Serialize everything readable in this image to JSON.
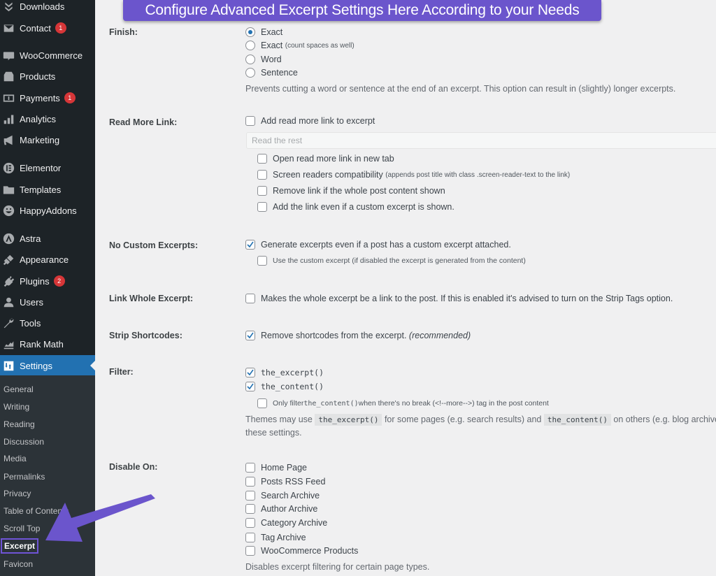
{
  "banner": {
    "text": "Configure Advanced Excerpt Settings Here According to your Needs"
  },
  "sidebar": {
    "items": [
      {
        "label": "Downloads",
        "icon": "download-icon",
        "badge": null
      },
      {
        "label": "Contact",
        "icon": "mail-icon",
        "badge": "1"
      },
      {
        "label": "WooCommerce",
        "icon": "woocommerce-icon",
        "badge": null
      },
      {
        "label": "Products",
        "icon": "archive-box-icon",
        "badge": null
      },
      {
        "label": "Payments",
        "icon": "payment-icon",
        "badge": "1"
      },
      {
        "label": "Analytics",
        "icon": "bar-chart-icon",
        "badge": null
      },
      {
        "label": "Marketing",
        "icon": "megaphone-icon",
        "badge": null
      },
      {
        "label": "Elementor",
        "icon": "elementor-icon",
        "badge": null
      },
      {
        "label": "Templates",
        "icon": "folder-icon",
        "badge": null
      },
      {
        "label": "HappyAddons",
        "icon": "happy-face-icon",
        "badge": null
      },
      {
        "label": "Astra",
        "icon": "astra-icon",
        "badge": null
      },
      {
        "label": "Appearance",
        "icon": "paintbrush-icon",
        "badge": null
      },
      {
        "label": "Plugins",
        "icon": "plug-icon",
        "badge": "2"
      },
      {
        "label": "Users",
        "icon": "user-icon",
        "badge": null
      },
      {
        "label": "Tools",
        "icon": "wrench-icon",
        "badge": null
      },
      {
        "label": "Rank Math",
        "icon": "rank-math-icon",
        "badge": null
      },
      {
        "label": "Settings",
        "icon": "settings-icon",
        "badge": null,
        "active": true
      }
    ],
    "submenu": [
      {
        "label": "General"
      },
      {
        "label": "Writing"
      },
      {
        "label": "Reading"
      },
      {
        "label": "Discussion"
      },
      {
        "label": "Media"
      },
      {
        "label": "Permalinks"
      },
      {
        "label": "Privacy"
      },
      {
        "label": "Table of Contents"
      },
      {
        "label": "Scroll Top"
      },
      {
        "label": "Excerpt",
        "current": true
      },
      {
        "label": "Favicon"
      }
    ]
  },
  "form": {
    "finish": {
      "label": "Finish:",
      "options": [
        {
          "label": "Exact",
          "note": "",
          "selected": true
        },
        {
          "label": "Exact",
          "note": "(count spaces as well)",
          "selected": false
        },
        {
          "label": "Word",
          "note": "",
          "selected": false
        },
        {
          "label": "Sentence",
          "note": "",
          "selected": false
        }
      ],
      "description": "Prevents cutting a word or sentence at the end of an excerpt. This option can result in (slightly) longer excerpts."
    },
    "read_more": {
      "label": "Read More Link:",
      "main": {
        "label": "Add read more link to excerpt",
        "checked": false
      },
      "input_placeholder": "Read the rest",
      "input_value": "",
      "options": [
        {
          "label": "Open read more link in new tab",
          "note": "",
          "checked": false
        },
        {
          "label": "Screen readers compatibility",
          "note": "(appends post title with class .screen-reader-text to the link)",
          "checked": false
        },
        {
          "label": "Remove link if the whole post content shown",
          "note": "",
          "checked": false
        },
        {
          "label": "Add the link even if a custom excerpt is shown.",
          "note": "",
          "checked": false
        }
      ]
    },
    "no_custom": {
      "label": "No Custom Excerpts:",
      "main": {
        "label": "Generate excerpts even if a post has a custom excerpt attached.",
        "checked": true
      },
      "sub": {
        "label": "Use the custom excerpt (if disabled the excerpt is generated from the content)",
        "checked": false
      }
    },
    "link_whole": {
      "label": "Link Whole Excerpt:",
      "main": {
        "label": "Makes the whole excerpt be a link to the post. If this is enabled it's advised to turn on the Strip Tags option.",
        "checked": false
      }
    },
    "strip_shortcodes": {
      "label": "Strip Shortcodes:",
      "main": {
        "label": "Remove shortcodes from the excerpt.",
        "note": "(recommended)",
        "checked": true
      }
    },
    "filter": {
      "label": "Filter:",
      "options": [
        {
          "label": "the_excerpt()",
          "checked": true
        },
        {
          "label": "the_content()",
          "checked": true
        }
      ],
      "sub": {
        "label_pre": "Only filter ",
        "label_code": "the_content()",
        "label_post": " when there's no break (<!--more-->) tag in the post content",
        "checked": false
      },
      "description": {
        "part1": "Themes may use",
        "code1": "the_excerpt()",
        "part2": "for some pages (e.g. search results) and",
        "code2": "the_content()",
        "part3": "on others (e.g. blog archives). I",
        "line2": "these settings."
      }
    },
    "disable_on": {
      "label": "Disable On:",
      "options": [
        {
          "label": "Home Page",
          "checked": false
        },
        {
          "label": "Posts RSS Feed",
          "checked": false
        },
        {
          "label": "Search Archive",
          "checked": false
        },
        {
          "label": "Author Archive",
          "checked": false
        },
        {
          "label": "Category Archive",
          "checked": false
        },
        {
          "label": "Tag Archive",
          "checked": false
        },
        {
          "label": "WooCommerce Products",
          "checked": false
        }
      ],
      "description": "Disables excerpt filtering for certain page types."
    }
  },
  "colors": {
    "sidebar_bg": "#1d2327",
    "submenu_bg": "#2c3338",
    "active_blue": "#2271b1",
    "annotation_purple": "#6b55cc",
    "badge_red": "#d63638"
  }
}
